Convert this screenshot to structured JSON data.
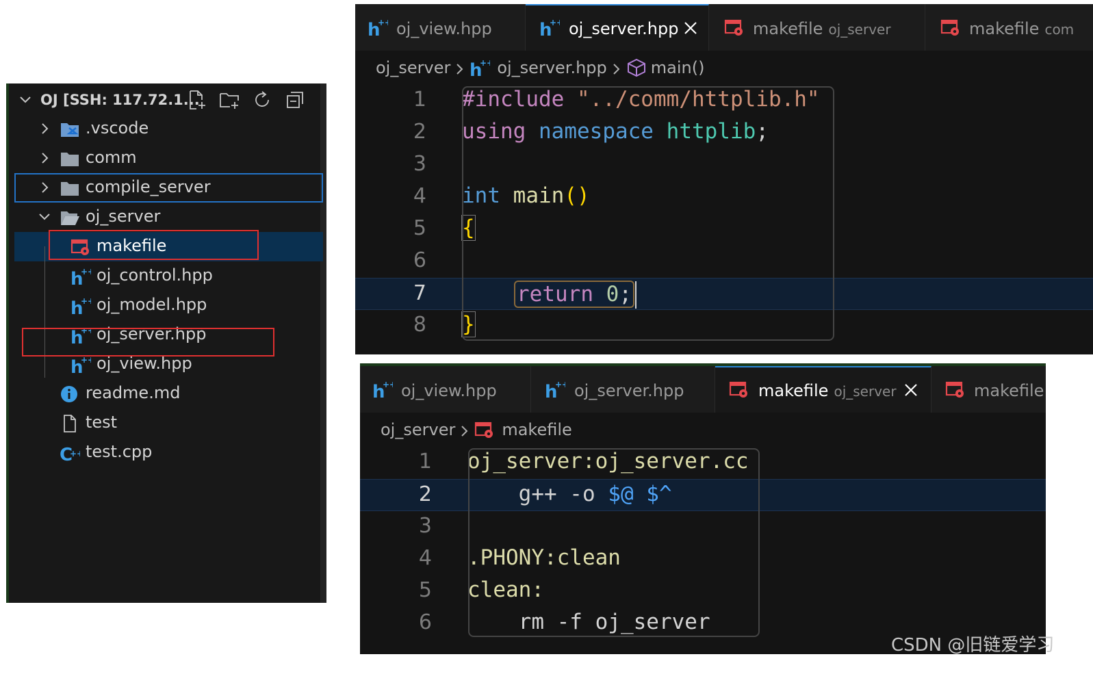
{
  "explorer": {
    "title": "OJ [SSH: 117.72.1...",
    "items": [
      {
        "label": ".vscode",
        "icon": "vscode-folder-icon",
        "expanded": false
      },
      {
        "label": "comm",
        "icon": "folder-icon",
        "expanded": false
      },
      {
        "label": "compile_server",
        "icon": "folder-icon",
        "expanded": false
      },
      {
        "label": "oj_server",
        "icon": "folder-open-icon",
        "expanded": true
      },
      {
        "label": "makefile",
        "icon": "makefile-icon"
      },
      {
        "label": "oj_control.hpp",
        "icon": "hpp-file-icon"
      },
      {
        "label": "oj_model.hpp",
        "icon": "hpp-file-icon"
      },
      {
        "label": "oj_server.hpp",
        "icon": "hpp-file-icon"
      },
      {
        "label": "oj_view.hpp",
        "icon": "hpp-file-icon"
      },
      {
        "label": "readme.md",
        "icon": "info-icon"
      },
      {
        "label": "test",
        "icon": "file-icon"
      },
      {
        "label": "test.cpp",
        "icon": "cpp-file-icon"
      }
    ]
  },
  "editor_top": {
    "tabs": [
      {
        "label": "oj_view.hpp",
        "desc": ""
      },
      {
        "label": "oj_server.hpp",
        "desc": ""
      },
      {
        "label": "makefile",
        "desc": "oj_server"
      },
      {
        "label": "makefile",
        "desc": "com"
      }
    ],
    "breadcrumb": [
      "oj_server",
      "oj_server.hpp",
      "main()"
    ],
    "line_numbers": [
      "1",
      "2",
      "3",
      "4",
      "5",
      "6",
      "7",
      "8"
    ],
    "code": {
      "l1_pre": "#include",
      "l1_str": "\"../comm/httplib.h\"",
      "l2_kw": "using",
      "l2_ns": "namespace",
      "l2_name": "httplib",
      "l2_end": ";",
      "l4_type": "int",
      "l4_fn": "main",
      "l4_par": "()",
      "l5": "{",
      "l7_kw": "return",
      "l7_num": "0",
      "l7_end": ";",
      "l8": "}"
    }
  },
  "editor_bottom": {
    "tabs": [
      {
        "label": "oj_view.hpp",
        "desc": ""
      },
      {
        "label": "oj_server.hpp",
        "desc": ""
      },
      {
        "label": "makefile",
        "desc": "oj_server"
      },
      {
        "label": "makefile",
        "desc": ""
      }
    ],
    "breadcrumb": [
      "oj_server",
      "makefile"
    ],
    "line_numbers": [
      "1",
      "2",
      "3",
      "4",
      "5",
      "6"
    ],
    "code": {
      "l1": "oj_server:oj_server.cc",
      "l2_cmd": "g++ -o ",
      "l2_vars": "$@ $^",
      "l4": ".PHONY:clean",
      "l5": "clean:",
      "l6": "rm -f oj_server"
    }
  },
  "watermark": "CSDN @旧链爱学习"
}
